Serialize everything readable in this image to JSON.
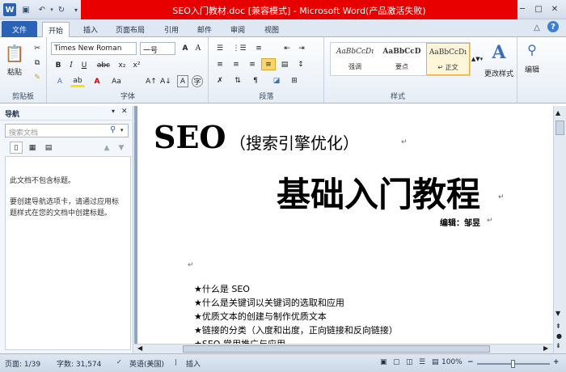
{
  "window": {
    "title": "SEO入门教材.doc [兼容模式] - Microsoft Word(产品激活失败)"
  },
  "tabs": [
    "文件",
    "开始",
    "插入",
    "页面布局",
    "引用",
    "邮件",
    "审阅",
    "视图"
  ],
  "clipboard": {
    "paste_label": "粘贴",
    "group_label": "剪贴板"
  },
  "font": {
    "name": "Times New Roman",
    "size": "一号",
    "group_label": "字体",
    "text_style_label": "Aa"
  },
  "paragraph": {
    "group_label": "段落"
  },
  "styles": {
    "group_label": "样式",
    "items": [
      {
        "sample": "AaBbCcDı",
        "name": "强调"
      },
      {
        "sample": "AaBbCcD",
        "name": "要点"
      },
      {
        "sample": "AaBbCcDı",
        "name": "↵ 正文"
      }
    ],
    "change_styles_label": "更改样式",
    "edit_label": "编辑"
  },
  "nav": {
    "title": "导航",
    "search_placeholder": "搜索文档",
    "no_headings": "此文档不包含标题。",
    "hint": "要创建导航选项卡，请通过应用标题样式在您的文档中创建标题。"
  },
  "document": {
    "title_seo": "SEO",
    "title_sub": "（搜索引擎优化）",
    "title_main": "基础入门教程",
    "editor": "编辑：邹昱",
    "list": [
      "★什么是 SEO",
      "★什么是关键词以关键词的选取和应用",
      "★优质文本的创建与制作优质文本",
      "★链接的分类（入度和出度，正向链接和反向链接）",
      "★SEO 常用推广与应用"
    ]
  },
  "status": {
    "page": "页面: 1/39",
    "words": "字数: 31,574",
    "lang": "英语(美国)",
    "mode": "插入",
    "zoom": "100%"
  },
  "colors": {
    "title_red": "#e80000",
    "file_tab": "#2a62b5"
  }
}
